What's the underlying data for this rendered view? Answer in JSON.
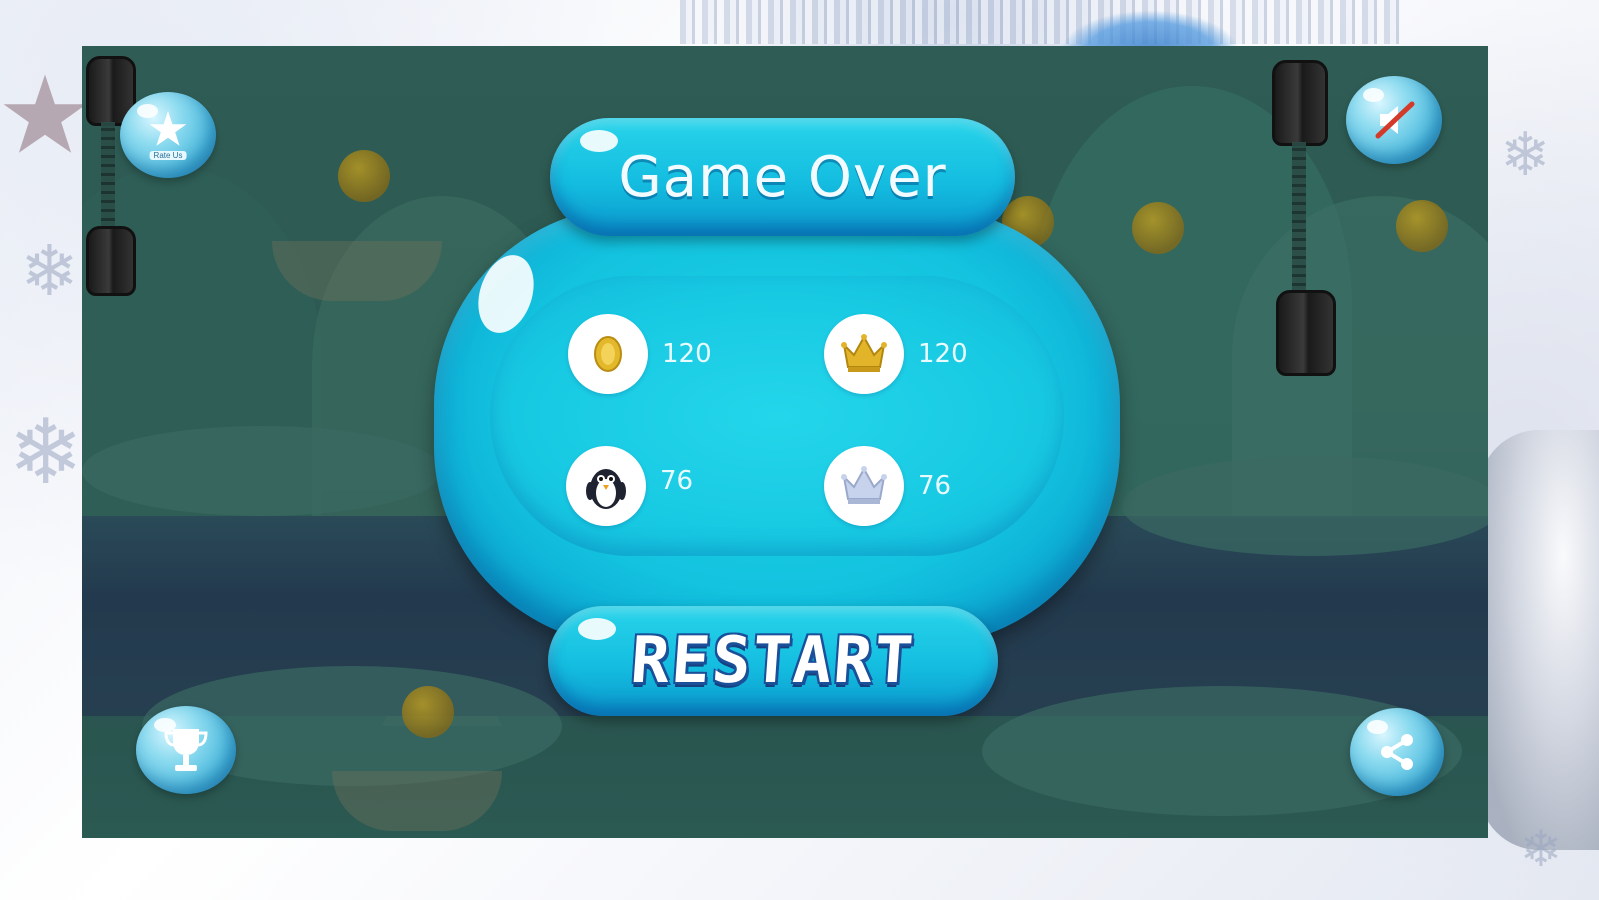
{
  "game_over": {
    "title": "Game Over",
    "restart_label": "RESTART"
  },
  "stats": [
    {
      "name": "coins",
      "icon": "coin-icon",
      "value": "120"
    },
    {
      "name": "best-coins",
      "icon": "crown-gold-icon",
      "value": "120"
    },
    {
      "name": "distance",
      "icon": "penguin-icon",
      "value": "76"
    },
    {
      "name": "best-distance",
      "icon": "crown-silver-icon",
      "value": "76"
    }
  ],
  "corner_buttons": {
    "rate": {
      "icon": "star-icon",
      "label": "Rate Us"
    },
    "sound": {
      "icon": "sound-muted-icon"
    },
    "leaderboard": {
      "icon": "trophy-icon"
    },
    "share": {
      "icon": "share-icon"
    }
  },
  "colors": {
    "panel": "#13c3df",
    "text_light": "#e8fbff",
    "restart_outline": "#1a4f9a",
    "coin": "#e3b82a"
  }
}
